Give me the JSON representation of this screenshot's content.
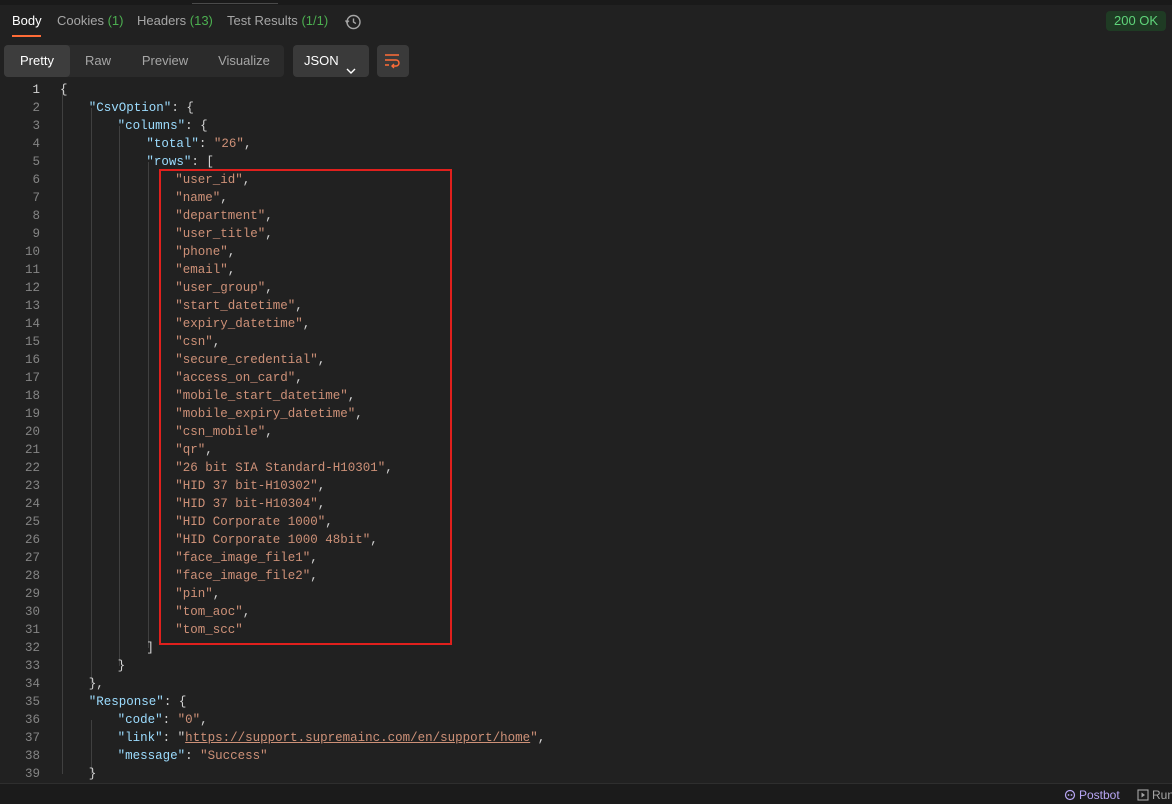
{
  "tabs": [
    {
      "label": "Body",
      "count": ""
    },
    {
      "label": "Cookies",
      "count": "(1)"
    },
    {
      "label": "Headers",
      "count": "(13)"
    },
    {
      "label": "Test Results",
      "count": "(1/1)"
    }
  ],
  "status": {
    "text": "200 OK",
    "color": "#5fd47a"
  },
  "view_modes": [
    "Pretty",
    "Raw",
    "Preview",
    "Visualize"
  ],
  "active_view": "Pretty",
  "format": "JSON",
  "icons": {
    "history": "history-icon",
    "wrap": "wrap-lines-icon",
    "chevron": "chevron-down-icon",
    "postbot": "postbot-icon",
    "run": "runner-icon"
  },
  "accent_color": "#ff6c37",
  "highlight_color": "#e0201d",
  "code_lines": [
    [
      {
        "t": "p",
        "v": "{"
      }
    ],
    [
      {
        "t": "k",
        "v": "\"CsvOption\""
      },
      {
        "t": "p",
        "v": ": {"
      }
    ],
    [
      {
        "t": "k",
        "v": "\"columns\""
      },
      {
        "t": "p",
        "v": ": {"
      }
    ],
    [
      {
        "t": "k",
        "v": "\"total\""
      },
      {
        "t": "p",
        "v": ": "
      },
      {
        "t": "s",
        "v": "\"26\""
      },
      {
        "t": "p",
        "v": ","
      }
    ],
    [
      {
        "t": "k",
        "v": "\"rows\""
      },
      {
        "t": "p",
        "v": ": ["
      }
    ],
    [
      {
        "t": "s",
        "v": "\"user_id\""
      },
      {
        "t": "p",
        "v": ","
      }
    ],
    [
      {
        "t": "s",
        "v": "\"name\""
      },
      {
        "t": "p",
        "v": ","
      }
    ],
    [
      {
        "t": "s",
        "v": "\"department\""
      },
      {
        "t": "p",
        "v": ","
      }
    ],
    [
      {
        "t": "s",
        "v": "\"user_title\""
      },
      {
        "t": "p",
        "v": ","
      }
    ],
    [
      {
        "t": "s",
        "v": "\"phone\""
      },
      {
        "t": "p",
        "v": ","
      }
    ],
    [
      {
        "t": "s",
        "v": "\"email\""
      },
      {
        "t": "p",
        "v": ","
      }
    ],
    [
      {
        "t": "s",
        "v": "\"user_group\""
      },
      {
        "t": "p",
        "v": ","
      }
    ],
    [
      {
        "t": "s",
        "v": "\"start_datetime\""
      },
      {
        "t": "p",
        "v": ","
      }
    ],
    [
      {
        "t": "s",
        "v": "\"expiry_datetime\""
      },
      {
        "t": "p",
        "v": ","
      }
    ],
    [
      {
        "t": "s",
        "v": "\"csn\""
      },
      {
        "t": "p",
        "v": ","
      }
    ],
    [
      {
        "t": "s",
        "v": "\"secure_credential\""
      },
      {
        "t": "p",
        "v": ","
      }
    ],
    [
      {
        "t": "s",
        "v": "\"access_on_card\""
      },
      {
        "t": "p",
        "v": ","
      }
    ],
    [
      {
        "t": "s",
        "v": "\"mobile_start_datetime\""
      },
      {
        "t": "p",
        "v": ","
      }
    ],
    [
      {
        "t": "s",
        "v": "\"mobile_expiry_datetime\""
      },
      {
        "t": "p",
        "v": ","
      }
    ],
    [
      {
        "t": "s",
        "v": "\"csn_mobile\""
      },
      {
        "t": "p",
        "v": ","
      }
    ],
    [
      {
        "t": "s",
        "v": "\"qr\""
      },
      {
        "t": "p",
        "v": ","
      }
    ],
    [
      {
        "t": "s",
        "v": "\"26 bit SIA Standard-H10301\""
      },
      {
        "t": "p",
        "v": ","
      }
    ],
    [
      {
        "t": "s",
        "v": "\"HID 37 bit-H10302\""
      },
      {
        "t": "p",
        "v": ","
      }
    ],
    [
      {
        "t": "s",
        "v": "\"HID 37 bit-H10304\""
      },
      {
        "t": "p",
        "v": ","
      }
    ],
    [
      {
        "t": "s",
        "v": "\"HID Corporate 1000\""
      },
      {
        "t": "p",
        "v": ","
      }
    ],
    [
      {
        "t": "s",
        "v": "\"HID Corporate 1000 48bit\""
      },
      {
        "t": "p",
        "v": ","
      }
    ],
    [
      {
        "t": "s",
        "v": "\"face_image_file1\""
      },
      {
        "t": "p",
        "v": ","
      }
    ],
    [
      {
        "t": "s",
        "v": "\"face_image_file2\""
      },
      {
        "t": "p",
        "v": ","
      }
    ],
    [
      {
        "t": "s",
        "v": "\"pin\""
      },
      {
        "t": "p",
        "v": ","
      }
    ],
    [
      {
        "t": "s",
        "v": "\"tom_aoc\""
      },
      {
        "t": "p",
        "v": ","
      }
    ],
    [
      {
        "t": "s",
        "v": "\"tom_scc\""
      }
    ],
    [
      {
        "t": "p",
        "v": "]"
      }
    ],
    [
      {
        "t": "p",
        "v": "}"
      }
    ],
    [
      {
        "t": "p",
        "v": "},"
      }
    ],
    [
      {
        "t": "k",
        "v": "\"Response\""
      },
      {
        "t": "p",
        "v": ": {"
      }
    ],
    [
      {
        "t": "k",
        "v": "\"code\""
      },
      {
        "t": "p",
        "v": ": "
      },
      {
        "t": "s",
        "v": "\"0\""
      },
      {
        "t": "p",
        "v": ","
      }
    ],
    [
      {
        "t": "k",
        "v": "\"link\""
      },
      {
        "t": "p",
        "v": ": \""
      },
      {
        "t": "lnk",
        "v": "https://support.supremainc.com/en/support/home"
      },
      {
        "t": "s",
        "v": "\""
      },
      {
        "t": "p",
        "v": ","
      }
    ],
    [
      {
        "t": "k",
        "v": "\"message\""
      },
      {
        "t": "p",
        "v": ": "
      },
      {
        "t": "s",
        "v": "\"Success\""
      }
    ],
    [
      {
        "t": "p",
        "v": "}"
      }
    ]
  ],
  "footer": {
    "postbot": "Postbot",
    "run": "Run"
  }
}
